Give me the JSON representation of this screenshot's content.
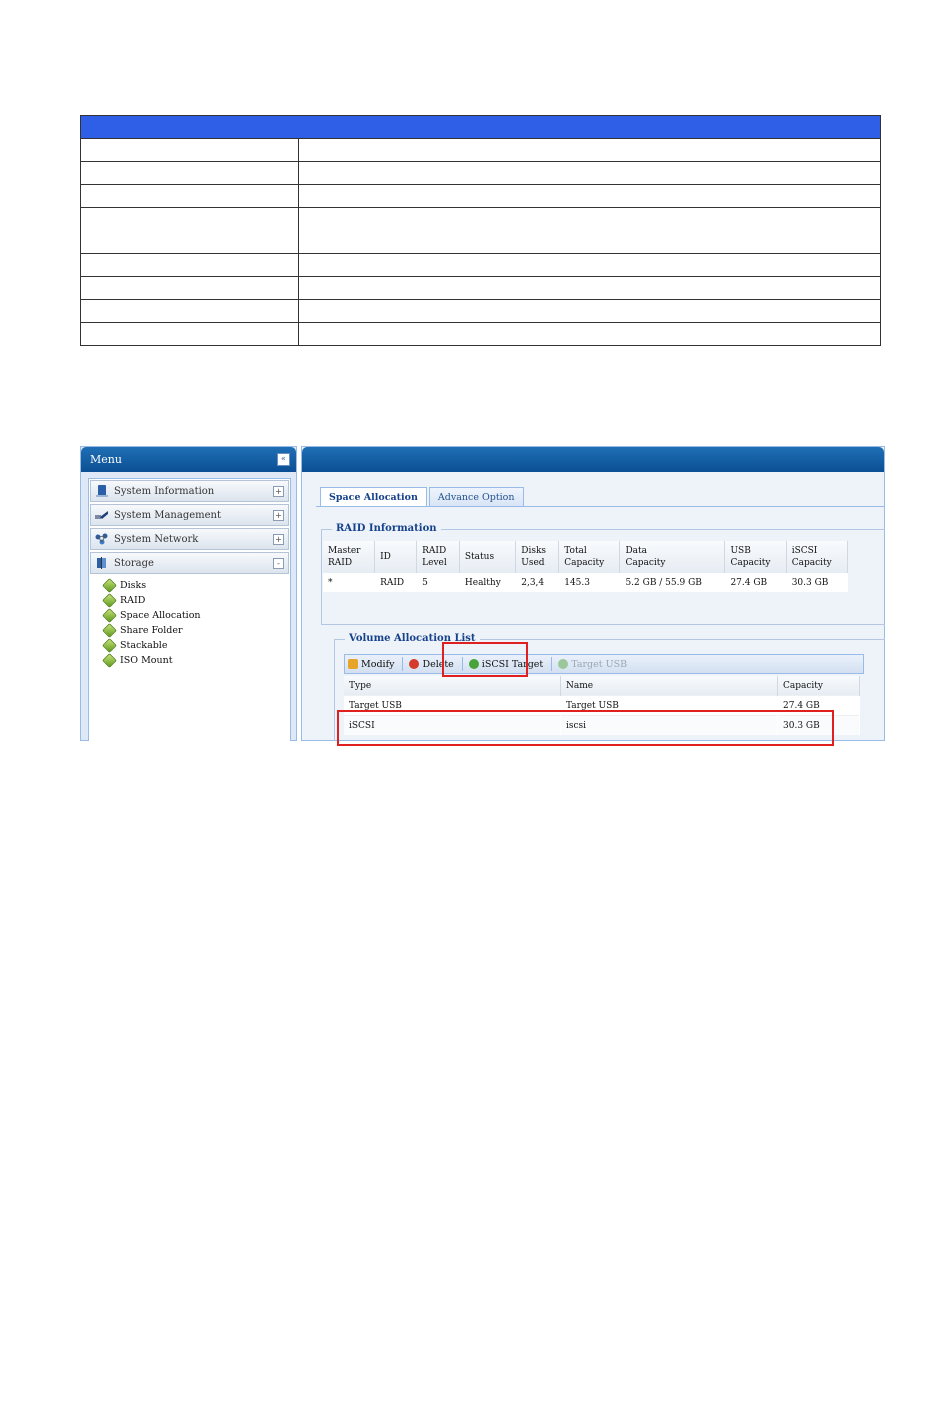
{
  "menu": {
    "title": "Menu",
    "collapse_glyph": "«",
    "sections": [
      {
        "label": "System Information",
        "toggle": "+"
      },
      {
        "label": "System Management",
        "toggle": "+"
      },
      {
        "label": "System Network",
        "toggle": "+"
      },
      {
        "label": "Storage",
        "toggle": "-"
      }
    ],
    "storage_items": [
      "Disks",
      "RAID",
      "Space Allocation",
      "Share Folder",
      "Stackable",
      "ISO Mount"
    ]
  },
  "tabs": [
    "Space Allocation",
    "Advance Option"
  ],
  "raid_info": {
    "legend": "RAID Information",
    "columns": [
      [
        "Master",
        "RAID"
      ],
      [
        "ID",
        ""
      ],
      [
        "RAID",
        "Level"
      ],
      [
        "Status",
        ""
      ],
      [
        "Disks",
        "Used"
      ],
      [
        "Total",
        "Capacity"
      ],
      [
        "Data",
        "Capacity"
      ],
      [
        "USB",
        "Capacity"
      ],
      [
        "iSCSI",
        "Capacity"
      ]
    ],
    "row": [
      "*",
      "RAID",
      "5",
      "Healthy",
      "2,3,4",
      "145.3",
      "5.2 GB / 55.9 GB",
      "27.4 GB",
      "30.3 GB"
    ]
  },
  "volume_list": {
    "legend": "Volume Allocation List",
    "toolbar": {
      "modify": "Modify",
      "delete": "Delete",
      "iscsi_target": "iSCSI Target",
      "target_usb": "Target USB"
    },
    "columns": [
      "Type",
      "Name",
      "Capacity"
    ],
    "rows": [
      [
        "Target USB",
        "Target USB",
        "27.4 GB"
      ],
      [
        "iSCSI",
        "iscsi",
        "30.3 GB"
      ]
    ]
  },
  "colors": {
    "header_bar": "#2f5fe6",
    "panel_header": "#0b4f94",
    "callout": "#e02020"
  }
}
